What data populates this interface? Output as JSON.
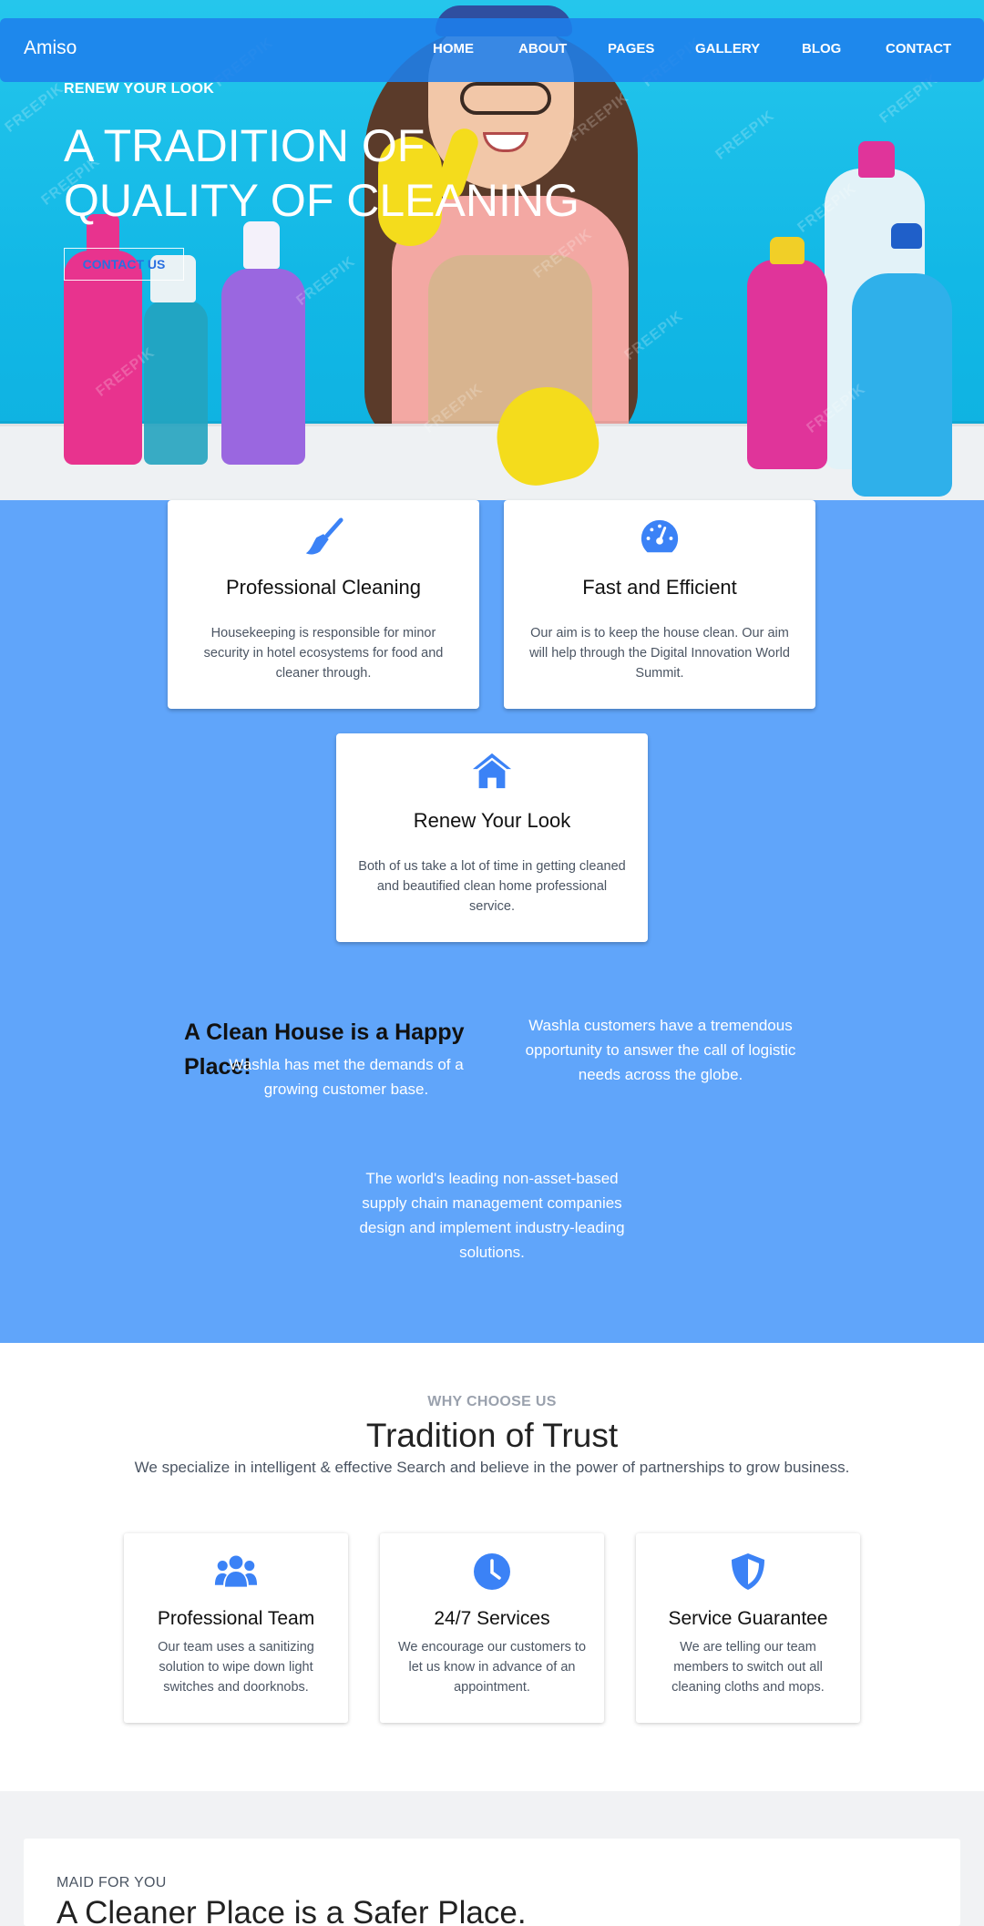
{
  "nav": {
    "brand": "Amiso",
    "items": [
      "HOME",
      "ABOUT",
      "PAGES",
      "GALLERY",
      "BLOG",
      "CONTACT"
    ]
  },
  "hero": {
    "eyebrow": "RENEW YOUR LOOK",
    "title": "A TRADITION OF QUALITY OF CLEANING",
    "button": "CONTACT US",
    "watermark": "FREEPIK"
  },
  "services": [
    {
      "icon": "broom-icon",
      "title": "Professional Cleaning",
      "text": "Housekeeping is responsible for minor security in hotel ecosystems for food and cleaner through."
    },
    {
      "icon": "gauge-icon",
      "title": "Fast and Efficient",
      "text": "Our aim is to keep the house clean. Our aim will help through the Digital Innovation World Summit."
    },
    {
      "icon": "home-icon",
      "title": "Renew Your Look",
      "text": "Both of us take a lot of time in getting cleaned and beautified clean home professional service."
    }
  ],
  "about": {
    "title": "A Clean House is a Happy Place!",
    "text1": "Washla has met the demands of a growing customer base.",
    "text2": "Washla customers have a tremendous opportunity to answer the call of logistic needs across the globe.",
    "text3": "The world's leading non-asset-based supply chain management companies design and implement industry-leading solutions."
  },
  "why": {
    "eyebrow": "WHY CHOOSE US",
    "title": "Tradition of Trust",
    "subtitle": "We specialize in intelligent & effective Search and believe in the power of partnerships to grow business.",
    "features": [
      {
        "icon": "users-icon",
        "title": "Professional Team",
        "text": "Our team uses a sanitizing solution to wipe down light switches and doorknobs."
      },
      {
        "icon": "clock-icon",
        "title": "24/7 Services",
        "text": "We encourage our customers to let us know in advance of an appointment."
      },
      {
        "icon": "shield-icon",
        "title": "Service Guarantee",
        "text": "We are telling our team members to switch out all cleaning cloths and mops."
      }
    ]
  },
  "maid": {
    "eyebrow": "MAID FOR YOU",
    "title": "A Cleaner Place is a Safer Place."
  },
  "colors": {
    "accent": "#3b82f6",
    "section_blue": "#60a5fa",
    "nav": "#1e80ec"
  }
}
